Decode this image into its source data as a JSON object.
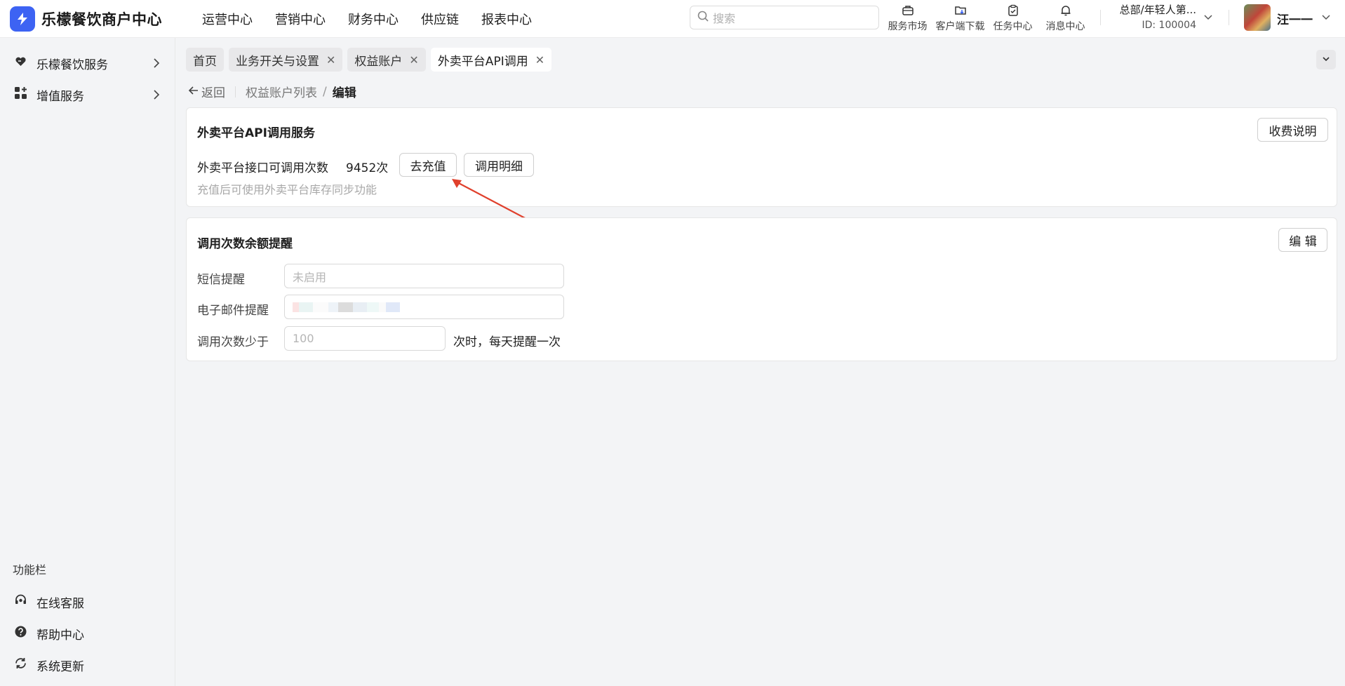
{
  "app": {
    "title": "乐檬餐饮商户中心"
  },
  "topnav": [
    "运营中心",
    "营销中心",
    "财务中心",
    "供应链",
    "报表中心"
  ],
  "search": {
    "placeholder": "搜索"
  },
  "tools": [
    {
      "label": "服务市场",
      "icon": "briefcase-icon"
    },
    {
      "label": "客户端下载",
      "icon": "folder-download-icon"
    },
    {
      "label": "任务中心",
      "icon": "clipboard-check-icon"
    },
    {
      "label": "消息中心",
      "icon": "bell-icon"
    }
  ],
  "org": {
    "name": "总部/年轻人第...",
    "id": "ID: 100004"
  },
  "user": {
    "name": "汪一一"
  },
  "sidebar": {
    "items": [
      {
        "label": "乐檬餐饮服务",
        "icon": "heart-hand-icon"
      },
      {
        "label": "增值服务",
        "icon": "apps-icon"
      }
    ],
    "section_title": "功能栏",
    "bottom_items": [
      {
        "label": "在线客服",
        "icon": "headset-icon"
      },
      {
        "label": "帮助中心",
        "icon": "help-circle-icon"
      },
      {
        "label": "系统更新",
        "icon": "refresh-icon"
      }
    ]
  },
  "tabs": [
    {
      "label": "首页",
      "closable": false
    },
    {
      "label": "业务开关与设置",
      "closable": true
    },
    {
      "label": "权益账户",
      "closable": true
    },
    {
      "label": "外卖平台API调用",
      "closable": true,
      "active": true
    }
  ],
  "breadcrumb": {
    "back": "返回",
    "parent": "权益账户列表",
    "separator": "/",
    "current": "编辑"
  },
  "service_card": {
    "title": "外卖平台API调用服务",
    "fee_button": "收费说明",
    "count_label": "外卖平台接口可调用次数",
    "count_value": "9452次",
    "recharge_button": "去充值",
    "detail_button": "调用明细",
    "hint": "充值后可使用外卖平台库存同步功能"
  },
  "reminder_card": {
    "title": "调用次数余额提醒",
    "edit_button": "编 辑",
    "sms_label": "短信提醒",
    "sms_value": "未启用",
    "email_label": "电子邮件提醒",
    "threshold_label": "调用次数少于",
    "threshold_value": "100",
    "threshold_suffix": "次时，每天提醒一次"
  },
  "colors": {
    "brand": "#3d63f3",
    "arrow": "#e0402c",
    "page_bg": "#f3f4f6"
  }
}
